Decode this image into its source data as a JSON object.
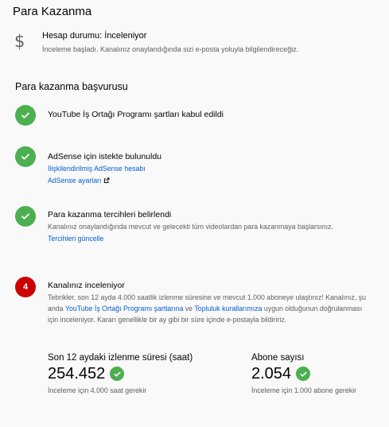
{
  "page": {
    "title": "Para Kazanma"
  },
  "status": {
    "title": "Hesap durumu: İnceleniyor",
    "description": "İnceleme başladı. Kanalınız onaylandığında sizi e-posta yoluyla bilgilendireceğiz.",
    "icon": "dollar-icon"
  },
  "application": {
    "title": "Para kazanma başvurusu",
    "steps": [
      {
        "state": "done",
        "title": "YouTube İş Ortağı Programı şartları kabul edildi"
      },
      {
        "state": "done",
        "title": "AdSense için istekte bulunuldu",
        "links": [
          "İlişkilendirilmiş AdSense hesabı",
          "AdSense ayarları"
        ]
      },
      {
        "state": "done",
        "title": "Para kazanma tercihleri belirlendi",
        "text": "Kanalınız onaylandığında mevcut ve gelecekti tüm videolardan para kazanmaya başlarsınız.",
        "link": "Tercihleri güncelle"
      },
      {
        "state": "active",
        "number": "4",
        "title": "Kanalınız inceleniyor",
        "text_part1": "Tebrikler, son 12 ayda 4.000 saatlik izlenme süresine ve mevcut 1.000 aboneye ulaştınız! Kanalınız, şu anda ",
        "link1": "YouTube İş Ortağı Programı şartlarına",
        "text_part2": " ve ",
        "link2": "Topluluk kurallarımıza",
        "text_part3": " uygun olduğunun doğrulanması için inceleniyor. Kararı genellikle bir ay gibi bir süre içinde e-postayla bildiririz."
      }
    ]
  },
  "metrics": {
    "watch_time": {
      "label": "Son 12 aydaki izlenme süresi (saat)",
      "value": "254.452",
      "note": "İnceleme için 4.000 saat gerekir"
    },
    "subscribers": {
      "label": "Abone sayısı",
      "value": "2.054",
      "note": "İnceleme için 1.000 abone gerekir"
    }
  },
  "colors": {
    "success": "#4caf50",
    "active": "#cc0000",
    "link": "#065fd4"
  }
}
